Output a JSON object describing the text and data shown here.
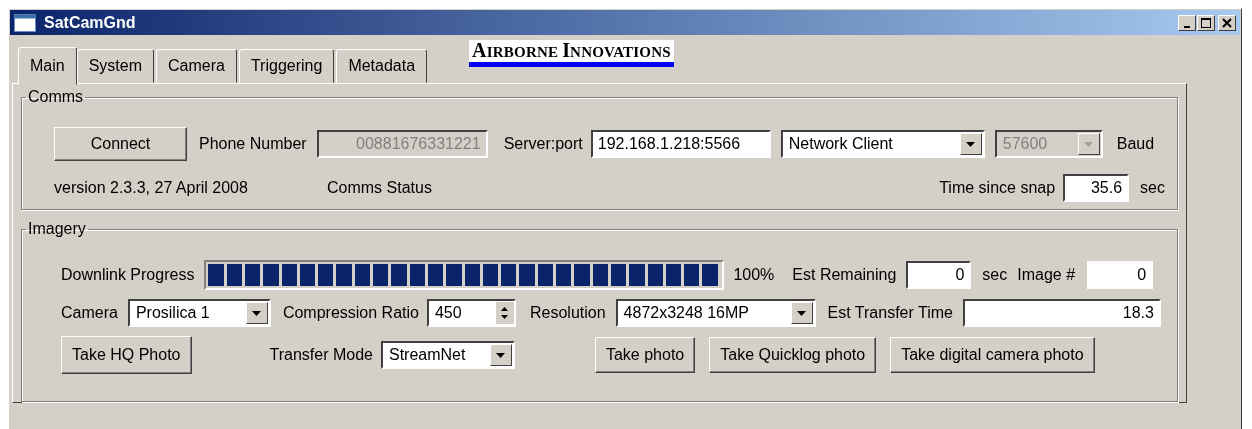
{
  "window": {
    "title": "SatCamGnd"
  },
  "tabs": [
    {
      "label": "Main",
      "selected": true
    },
    {
      "label": "System",
      "selected": false
    },
    {
      "label": "Camera",
      "selected": false
    },
    {
      "label": "Triggering",
      "selected": false
    },
    {
      "label": "Metadata",
      "selected": false
    }
  ],
  "logo": {
    "first": "A",
    "rest_1": "IRBORNE ",
    "second": "I",
    "rest_2": "NNOVATIONS"
  },
  "comms": {
    "title": "Comms",
    "connect_button": "Connect",
    "phone_label": "Phone Number",
    "phone_field": {
      "value": "00881676331221",
      "disabled": true
    },
    "server_label": "Server:port",
    "server_field": {
      "value": "192.168.1.218:5566",
      "disabled": false
    },
    "mode_dropdown": {
      "value": "Network Client",
      "disabled": false
    },
    "baud_dropdown": {
      "value": "57600",
      "disabled": true
    },
    "baud_label": "Baud",
    "version": "version 2.3.3, 27 April 2008",
    "status": "Comms Status",
    "time_label": "Time since snap",
    "time_value": "35.6",
    "time_unit": "sec"
  },
  "imagery": {
    "title": "Imagery",
    "progress_label": "Downlink Progress",
    "progress": {
      "level": 1
    },
    "progress_percent": "100%",
    "remaining_label": "Est Remaining",
    "remaining_value": "0",
    "remaining_unit": "sec",
    "image_label": "Image #",
    "image_value": "0",
    "camera_label": "Camera",
    "camera_dropdown": "Prosilica 1",
    "compression_label": "Compression Ratio",
    "compression_value": "450",
    "resolution_label": "Resolution",
    "resolution_dropdown": "4872x3248 16MP",
    "transfer_time_label": "Est Transfer Time",
    "transfer_time_value": "18.3",
    "hq_button": "Take HQ Photo",
    "mode_label": "Transfer Mode",
    "mode_dropdown": "StreamNet",
    "buttons": [
      "Take photo",
      "Take Quicklog photo",
      "Take digital camera photo"
    ]
  }
}
